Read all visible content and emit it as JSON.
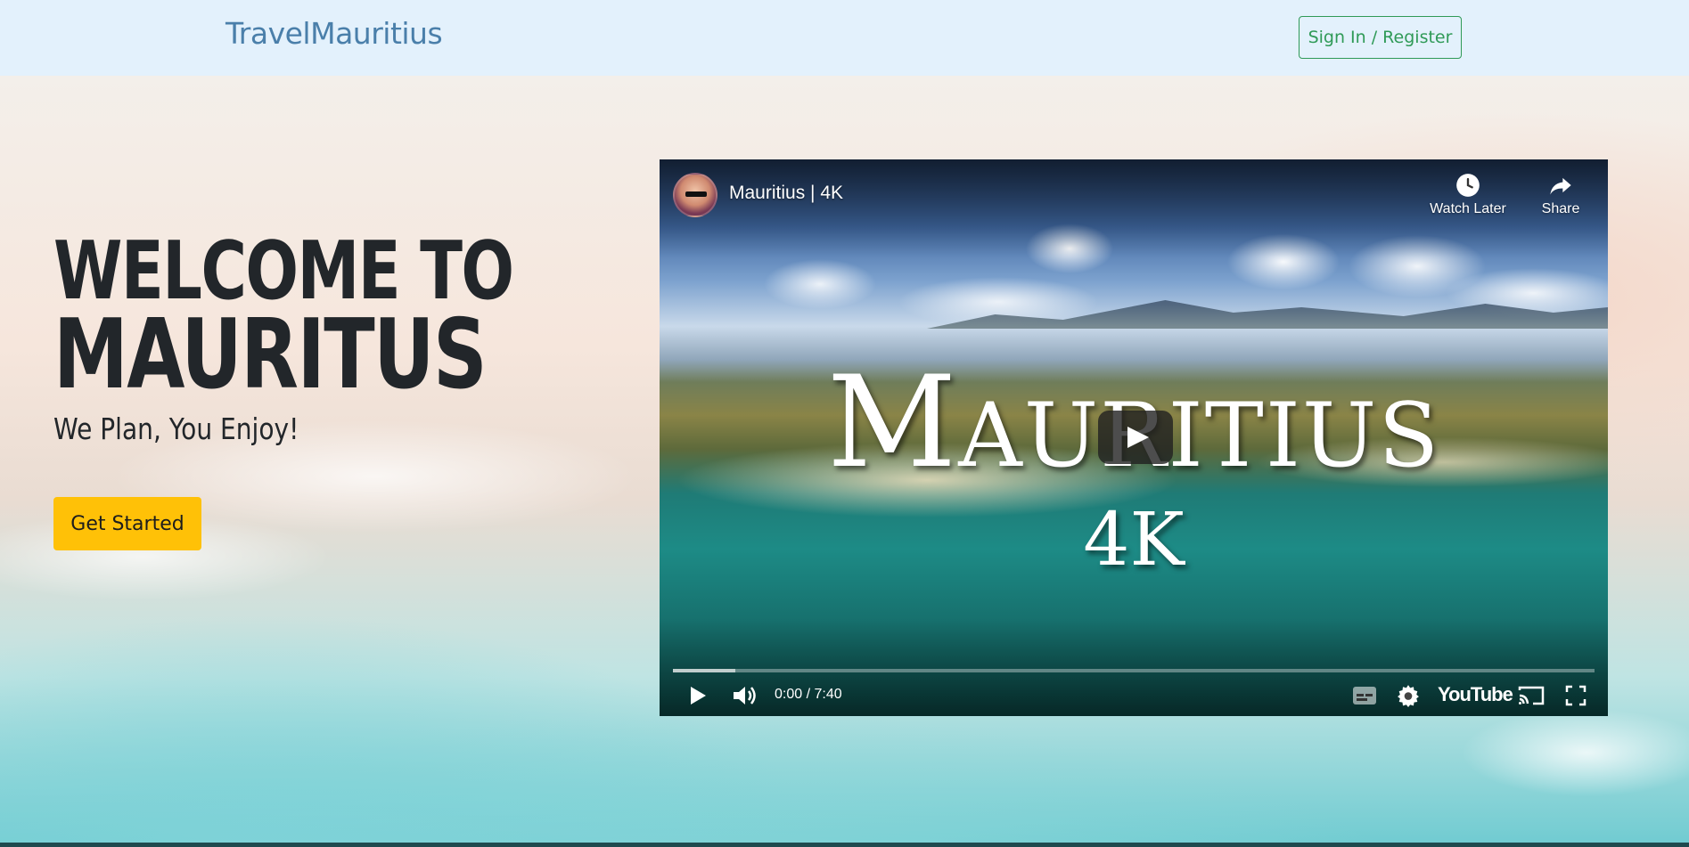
{
  "navbar": {
    "brand": "TravelMauritius",
    "signin_label": "Sign In / Register"
  },
  "hero": {
    "title_line1": "WELCOME TO",
    "title_line2": "MAURITUS",
    "subtitle": "We Plan, You Enjoy!",
    "cta_label": "Get Started"
  },
  "video": {
    "title": "Mauritius | 4K",
    "watch_later_label": "Watch Later",
    "share_label": "Share",
    "overlay_title": "Mauritius",
    "overlay_subtitle": "4K",
    "time_display": "0:00 / 7:40",
    "logo_text": "YouTube",
    "icons": [
      "channel-avatar",
      "clock-icon",
      "share-arrow-icon",
      "play-icon",
      "volume-icon",
      "subtitles-icon",
      "gear-icon",
      "cast-icon",
      "fullscreen-icon"
    ]
  },
  "colors": {
    "navbar_bg": "#e3f1fc",
    "brand": "#4a7faa",
    "signin_border": "#2f9a57",
    "cta_bg": "#ffc107",
    "heading": "#22262a"
  }
}
